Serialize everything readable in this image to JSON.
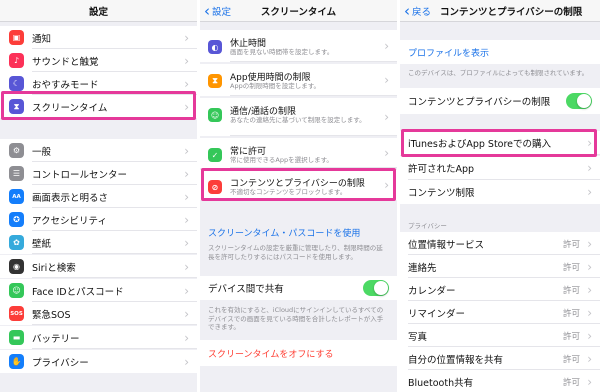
{
  "panel1": {
    "title": "設定",
    "items": [
      {
        "label": "通知",
        "icon": "notifications-icon",
        "color": "#fc3d39",
        "glyph": "▣"
      },
      {
        "label": "サウンドと触覚",
        "icon": "sounds-icon",
        "color": "#fc3158",
        "glyph": "♪"
      },
      {
        "label": "おやすみモード",
        "icon": "do-not-disturb-icon",
        "color": "#5856d6",
        "glyph": "☾"
      },
      {
        "label": "スクリーンタイム",
        "icon": "screen-time-icon",
        "color": "#5856d6",
        "glyph": "⧗"
      },
      {
        "label": "一般",
        "icon": "general-icon",
        "color": "#8e8e93",
        "glyph": "⚙"
      },
      {
        "label": "コントロールセンター",
        "icon": "control-center-icon",
        "color": "#8e8e93",
        "glyph": "☰"
      },
      {
        "label": "画面表示と明るさ",
        "icon": "display-brightness-icon",
        "color": "#147efb",
        "glyph": "AA"
      },
      {
        "label": "アクセシビリティ",
        "icon": "accessibility-icon",
        "color": "#147efb",
        "glyph": "✪"
      },
      {
        "label": "壁紙",
        "icon": "wallpaper-icon",
        "color": "#35aadc",
        "glyph": "✿"
      },
      {
        "label": "Siriと検索",
        "icon": "siri-icon",
        "color": "#333333",
        "glyph": "◉"
      },
      {
        "label": "Face IDとパスコード",
        "icon": "face-id-icon",
        "color": "#34c759",
        "glyph": "☺"
      },
      {
        "label": "緊急SOS",
        "icon": "sos-icon",
        "color": "#fc3d39",
        "glyph": "SOS"
      },
      {
        "label": "バッテリー",
        "icon": "battery-icon",
        "color": "#34c759",
        "glyph": "▬"
      },
      {
        "label": "プライバシー",
        "icon": "privacy-icon",
        "color": "#147efb",
        "glyph": "✋"
      }
    ]
  },
  "panel2": {
    "back": "設定",
    "title": "スクリーンタイム",
    "items": [
      {
        "label": "休止時間",
        "sub": "画面を見ない時間帯を設定します。",
        "icon": "downtime-icon",
        "color": "#5856d6",
        "glyph": "◐"
      },
      {
        "label": "App使用時間の制限",
        "sub": "Appの制限時間を設定します。",
        "icon": "app-limits-icon",
        "color": "#ff9500",
        "glyph": "⧗"
      },
      {
        "label": "通信/通話の制限",
        "sub": "あなたの連絡先に基づいて制限を設定します。",
        "icon": "communication-limits-icon",
        "color": "#34c759",
        "glyph": "☺"
      },
      {
        "label": "常に許可",
        "sub": "常に使用できるAppを選択します。",
        "icon": "always-allowed-icon",
        "color": "#34c759",
        "glyph": "✓"
      },
      {
        "label": "コンテンツとプライバシーの制限",
        "sub": "不適切なコンテンツをブロックします。",
        "icon": "content-restrictions-icon",
        "color": "#fc3d39",
        "glyph": "⊘"
      }
    ],
    "passcode_link": "スクリーンタイム・パスコードを使用",
    "passcode_note": "スクリーンタイムの設定を厳重に管理したり、制限時間の延長を許可したりするにはパスコードを使用します。",
    "share_label": "デバイス間で共有",
    "share_note": "これを有効にすると、iCloudにサインインしているすべてのデバイスでの画面を見ている時間を合計したレポートが入手できます。",
    "turn_off": "スクリーンタイムをオフにする"
  },
  "panel3": {
    "back": "戻る",
    "title": "コンテンツとプライバシーの制限",
    "profile_link": "プロファイルを表示",
    "profile_note": "このデバイスは、プロファイルによっても制限されています。",
    "toggle_label": "コンテンツとプライバシーの制限",
    "items": [
      {
        "label": "iTunesおよびApp Storeでの購入"
      },
      {
        "label": "許可されたApp"
      },
      {
        "label": "コンテンツ制限"
      }
    ],
    "privacy_header": "プライバシー",
    "privacy_items": [
      {
        "label": "位置情報サービス",
        "value": "許可"
      },
      {
        "label": "連絡先",
        "value": "許可"
      },
      {
        "label": "カレンダー",
        "value": "許可"
      },
      {
        "label": "リマインダー",
        "value": "許可"
      },
      {
        "label": "写真",
        "value": "許可"
      },
      {
        "label": "自分の位置情報を共有",
        "value": "許可"
      },
      {
        "label": "Bluetooth共有",
        "value": "許可"
      }
    ]
  }
}
